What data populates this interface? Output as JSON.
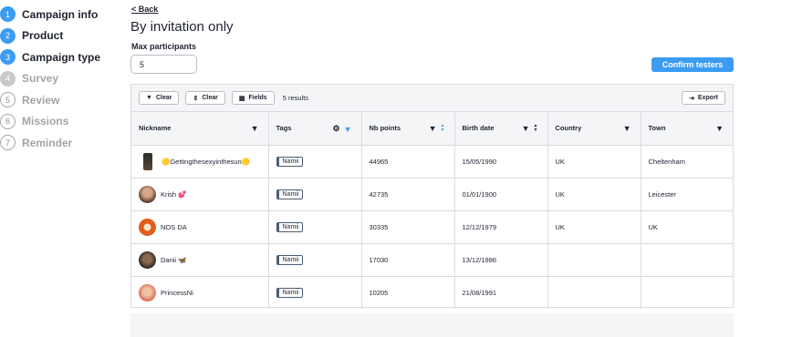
{
  "steps": [
    {
      "num": "1",
      "label": "Campaign info"
    },
    {
      "num": "2",
      "label": "Product"
    },
    {
      "num": "3",
      "label": "Campaign type"
    },
    {
      "num": "4",
      "label": "Survey"
    },
    {
      "num": "5",
      "label": "Review"
    },
    {
      "num": "6",
      "label": "Missions"
    },
    {
      "num": "7",
      "label": "Reminder"
    }
  ],
  "header": {
    "back_label": "< Back",
    "title": "By invitation only",
    "max_label": "Max participants",
    "max_value": "5",
    "confirm_label": "Confirm testers"
  },
  "toolbar": {
    "filter_clear": "Clear",
    "sort_clear": "Clear",
    "fields": "Fields",
    "results": "5 results",
    "export": "Export"
  },
  "columns": [
    "Nickname",
    "Tags",
    "Nb points",
    "Birth date",
    "Country",
    "Town"
  ],
  "rows": [
    {
      "nickname": "🟡Gettingthesexyinthesun🟡",
      "tag": "Namii",
      "points": "44965",
      "birth": "15/05/1990",
      "country": "UK",
      "town": "Cheltenham"
    },
    {
      "nickname": "Krish 💕",
      "tag": "Namii",
      "points": "42735",
      "birth": "01/01/1900",
      "country": "UK",
      "town": "Leicester"
    },
    {
      "nickname": "NOS DA",
      "tag": "Namii",
      "points": "30335",
      "birth": "12/12/1979",
      "country": "UK",
      "town": "UK"
    },
    {
      "nickname": "Danii 🦋",
      "tag": "Namii",
      "points": "17030",
      "birth": "13/12/1986",
      "country": "",
      "town": ""
    },
    {
      "nickname": "PrincessNi",
      "tag": "Namii",
      "points": "10205",
      "birth": "21/08/1991",
      "country": "",
      "town": ""
    }
  ],
  "colors": {
    "accent": "#3b9cf1",
    "panel_bg": "#f4f5f7",
    "border": "#d9dbe0"
  }
}
